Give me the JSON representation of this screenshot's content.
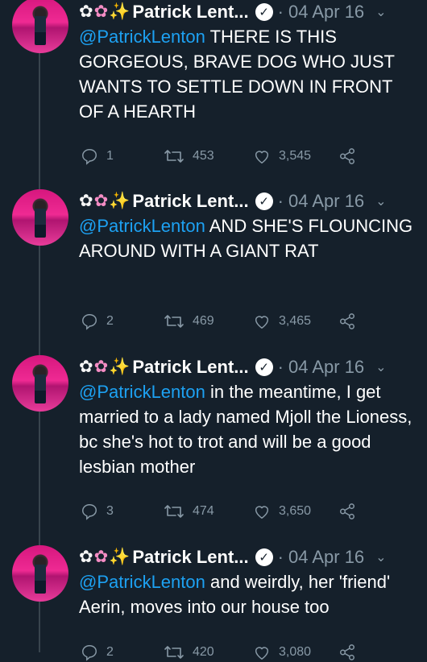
{
  "tweets": [
    {
      "emoji": [
        "✿",
        "✿",
        "✨"
      ],
      "name": "Patrick Lent...",
      "verified_mark": "✓",
      "dot": "·",
      "date": "04 Apr 16",
      "chevron": "⌄",
      "mention": "@PatrickLenton",
      "text": " THERE IS THIS GORGEOUS, BRAVE DOG WHO JUST WANTS TO SETTLE DOWN IN FRONT OF A HEARTH",
      "replies": "1",
      "retweets": "453",
      "likes": "3,545"
    },
    {
      "emoji": [
        "✿",
        "✿",
        "✨"
      ],
      "name": "Patrick Lent...",
      "verified_mark": "✓",
      "dot": "·",
      "date": "04 Apr 16",
      "chevron": "⌄",
      "mention": "@PatrickLenton",
      "text": " AND SHE'S FLOUNCING AROUND WITH A GIANT RAT",
      "replies": "2",
      "retweets": "469",
      "likes": "3,465"
    },
    {
      "emoji": [
        "✿",
        "✿",
        "✨"
      ],
      "name": "Patrick Lent...",
      "verified_mark": "✓",
      "dot": "·",
      "date": "04 Apr 16",
      "chevron": "⌄",
      "mention": "@PatrickLenton",
      "text": " in the meantime, I get married to a lady named Mjoll the Lioness, bc she's hot to trot and will be a good lesbian mother",
      "replies": "3",
      "retweets": "474",
      "likes": "3,650"
    },
    {
      "emoji": [
        "✿",
        "✿",
        "✨"
      ],
      "name": "Patrick Lent...",
      "verified_mark": "✓",
      "dot": "·",
      "date": "04 Apr 16",
      "chevron": "⌄",
      "mention": "@PatrickLenton",
      "text": " and weirdly, her 'friend' Aerin, moves into our house too",
      "replies": "2",
      "retweets": "420",
      "likes": "3,080"
    }
  ],
  "colors": {
    "background": "#15202b",
    "text": "#ffffff",
    "secondary": "#8899a6",
    "link": "#1da1f2",
    "thread_line": "#38444d"
  },
  "icons": {
    "reply": "reply-icon",
    "retweet": "retweet-icon",
    "like": "heart-icon",
    "share": "share-icon",
    "verified": "verified-badge-icon",
    "menu": "chevron-down-icon"
  }
}
